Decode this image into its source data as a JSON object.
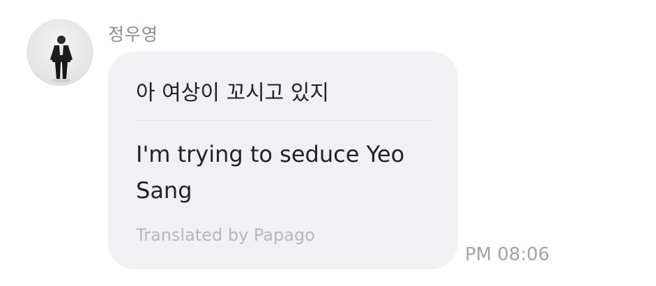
{
  "message": {
    "sender_name": "정우영",
    "original_text": "아 여상이 꼬시고 있지",
    "translated_text": "I'm trying to seduce Yeo Sang",
    "translator_credit": "Translated by Papago",
    "timestamp": "PM 08:06"
  },
  "colors": {
    "bubble_background": "#f1f1f4",
    "text_primary": "#222222",
    "text_muted": "#a4a4a8"
  },
  "icons": {
    "avatar": "profile-photo"
  }
}
